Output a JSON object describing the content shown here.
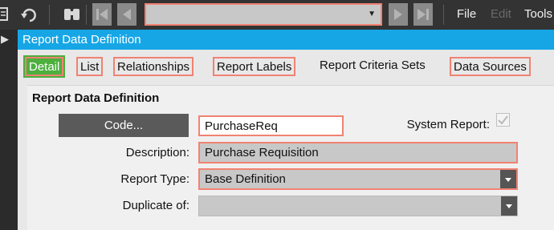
{
  "toolbar": {
    "icons": [
      "report-icon",
      "undo-icon",
      "binoculars-icon",
      "first-record-icon",
      "previous-record-icon",
      "next-record-icon",
      "last-record-icon"
    ],
    "record_combo_value": "",
    "menus": {
      "file": "File",
      "edit": "Edit",
      "tools": "Tools"
    }
  },
  "window": {
    "title": "Report Data Definition"
  },
  "tabs": [
    {
      "label": "Detail",
      "active": true
    },
    {
      "label": "List"
    },
    {
      "label": "Relationships"
    },
    {
      "label": "Report Labels"
    },
    {
      "label": "Report Criteria Sets"
    },
    {
      "label": "Data Sources"
    }
  ],
  "panel": {
    "title": "Report Data Definition",
    "code_button": "Code...",
    "code_value": "PurchaseReq",
    "system_report_label": "System Report:",
    "system_report_checked": true,
    "description_label": "Description:",
    "description_value": "Purchase Requisition",
    "report_type_label": "Report Type:",
    "report_type_value": "Base Definition",
    "duplicate_of_label": "Duplicate of:",
    "duplicate_of_value": ""
  },
  "colors": {
    "titlebar": "#16a6e6",
    "active_tab": "#4caf3e",
    "highlight_border": "#f08272",
    "toolbar_bg": "#333333"
  }
}
